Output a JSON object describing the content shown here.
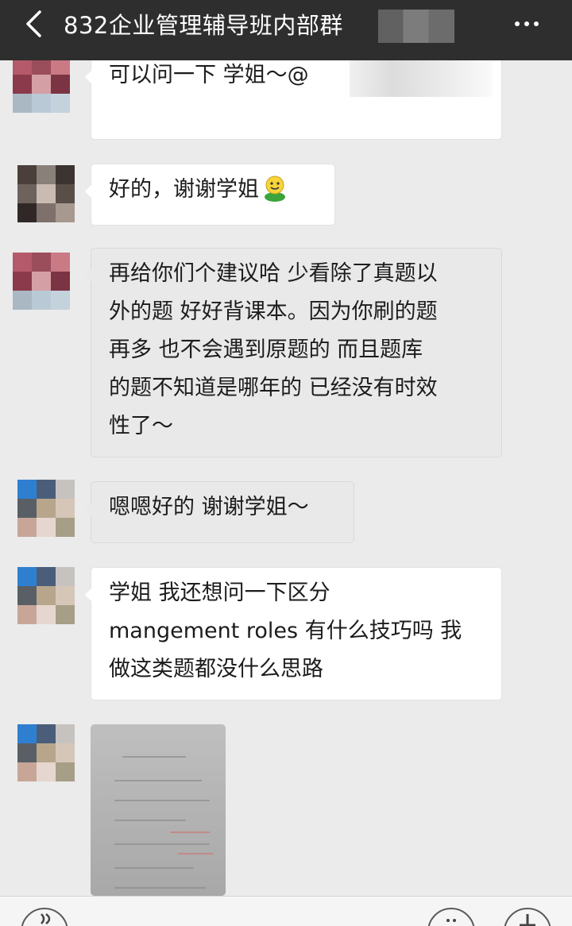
{
  "header": {
    "title": "832企业管理辅导班内部群",
    "back_icon": "chevron-left-icon",
    "more_icon": "ellipsis-icon"
  },
  "messages": [
    {
      "type": "text",
      "lines": [
        "可以问一下    学姐～@"
      ]
    },
    {
      "type": "text",
      "lines": [
        "好的，谢谢学姐"
      ],
      "emoji": "smiley-face-icon"
    },
    {
      "type": "text",
      "lines": [
        "再给你们个建议哈 少看除了真题以",
        "外的题 好好背课本。因为你刷的题",
        "再多 也不会遇到原题的 而且题库",
        "的题不知道是哪年的 已经没有时效",
        "性了～"
      ]
    },
    {
      "type": "text",
      "lines": [
        "嗯嗯好的 谢谢学姐～"
      ]
    },
    {
      "type": "text",
      "lines": [
        "学姐 我还想问一下区分",
        "mangement roles 有什么技巧吗 我",
        "做这类题都没什么思路"
      ]
    },
    {
      "type": "image",
      "alt": ""
    }
  ],
  "bottom": {
    "voice_icon": "voice-icon",
    "emoji_icon": "emoji-icon",
    "plus_icon": "plus-icon"
  },
  "colors": {
    "header_bg": "#2e2e2e",
    "chat_bg": "#ebebeb",
    "bubble_bg": "#ffffff"
  }
}
